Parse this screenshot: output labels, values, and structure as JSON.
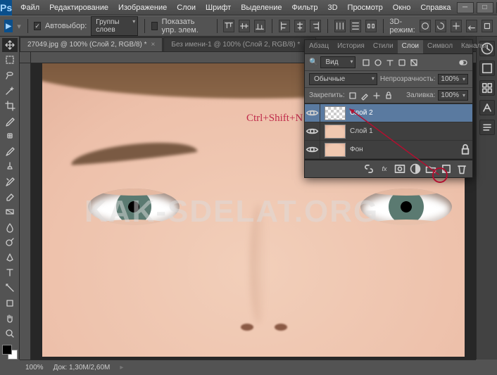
{
  "app": {
    "logo": "Ps"
  },
  "menu": [
    "Файл",
    "Редактирование",
    "Изображение",
    "Слои",
    "Шрифт",
    "Выделение",
    "Фильтр",
    "3D",
    "Просмотр",
    "Окно",
    "Справка"
  ],
  "options": {
    "autoselect_label": "Автовыбор:",
    "autoselect_mode": "Группы слоев",
    "show_transform_label": "Показать упр. элем.",
    "mode3d_label": "3D-режим:"
  },
  "tabs": [
    {
      "title": "27049.jpg @ 100% (Слой 2, RGB/8) *",
      "active": true
    },
    {
      "title": "Без имени-1 @ 100% (Слой 2, RGB/8) *",
      "active": false
    }
  ],
  "overlay": {
    "shortcut_text": "Ctrl+Shift+N",
    "watermark": "KAK-SDELAT.ORG"
  },
  "layers_panel": {
    "tabs": [
      "Абзац",
      "История",
      "Стили",
      "Слои",
      "Символ",
      "Каналы"
    ],
    "active_tab": "Слои",
    "filter_label": "Вид",
    "blend_mode": "Обычные",
    "opacity_label": "Непрозрачность:",
    "opacity_value": "100%",
    "lock_label": "Закрепить:",
    "fill_label": "Заливка:",
    "fill_value": "100%",
    "layers": [
      {
        "name": "Слой 2",
        "visible": true,
        "selected": true,
        "thumb": "trans",
        "locked": false
      },
      {
        "name": "Слой 1",
        "visible": true,
        "selected": false,
        "thumb": "face",
        "locked": false
      },
      {
        "name": "Фон",
        "visible": true,
        "selected": false,
        "thumb": "face",
        "locked": true
      }
    ]
  },
  "status": {
    "zoom": "100%",
    "docinfo_label": "Док:",
    "docinfo_value": "1,30M/2,60M"
  },
  "colors": {
    "accent": "#0a4f8c",
    "annotation": "#b01030",
    "shortcut": "#c02a4a"
  }
}
